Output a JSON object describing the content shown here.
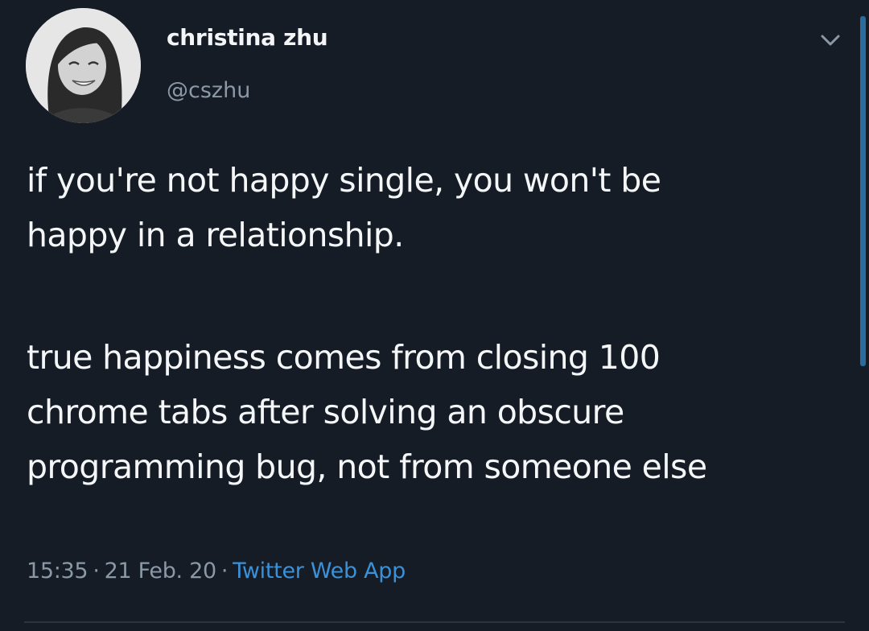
{
  "tweet": {
    "author": {
      "display_name": "christina zhu",
      "handle": "@cszhu",
      "avatar_icon": "profile-photo"
    },
    "menu_icon": "chevron-down-icon",
    "text_lines_para1": [
      "if you're not happy single, you won't be",
      "happy in a relationship."
    ],
    "text_lines_para2": [
      "true happiness comes from closing 100",
      "chrome tabs after solving an obscure",
      "programming bug, not from someone else"
    ],
    "time": "15:35",
    "date": "21 Feb. 20",
    "separator": "·",
    "source": "Twitter Web App",
    "colors": {
      "background": "#151c26",
      "text": "#f4f6f8",
      "secondary": "#8b98a5",
      "link": "#3a91d8"
    }
  }
}
